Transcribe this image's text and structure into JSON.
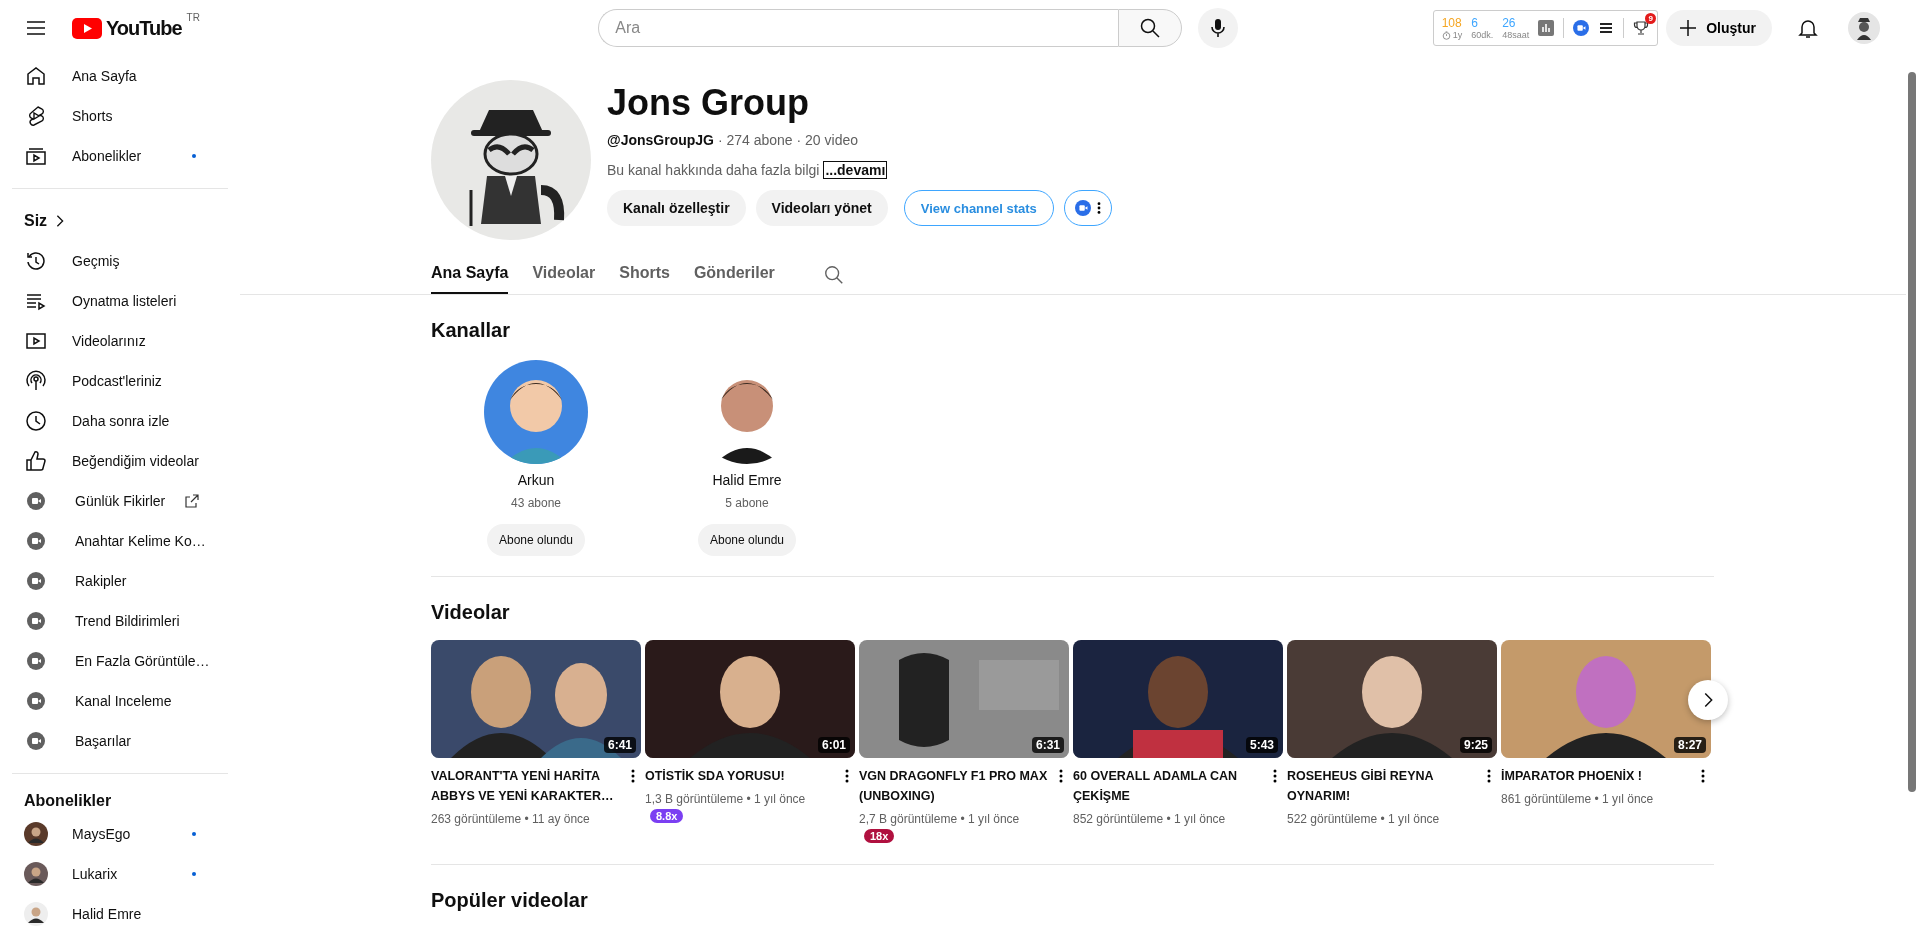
{
  "topbar": {
    "logo": "YouTube",
    "region": "TR",
    "search": {
      "placeholder": "Ara"
    },
    "extension": {
      "stats": [
        {
          "value": "108",
          "label": "1y",
          "color": "#f5a623"
        },
        {
          "value": "6",
          "label": "60dk.",
          "color": "#3ea6ff"
        },
        {
          "value": "26",
          "label": "48saat",
          "color": "#3ea6ff"
        }
      ],
      "badge": "9"
    },
    "create_button": "Oluştur"
  },
  "sidebar": {
    "main": [
      {
        "label": "Ana Sayfa",
        "new": false
      },
      {
        "label": "Shorts",
        "new": false
      },
      {
        "label": "Abonelikler",
        "new": true
      }
    ],
    "you": {
      "title": "Siz",
      "items": [
        {
          "label": "Geçmiş",
          "kind": "link",
          "external": false
        },
        {
          "label": "Oynatma listeleri",
          "kind": "link",
          "external": false
        },
        {
          "label": "Videolarınız",
          "kind": "link",
          "external": false
        },
        {
          "label": "Podcast'leriniz",
          "kind": "link",
          "external": false
        },
        {
          "label": "Daha sonra izle",
          "kind": "link",
          "external": false
        },
        {
          "label": "Beğendiğim videolar",
          "kind": "link",
          "external": false
        },
        {
          "label": "Günlük Fikirler",
          "kind": "extension",
          "external": true
        },
        {
          "label": "Anahtar Kelime Ko…",
          "kind": "extension",
          "external": false
        },
        {
          "label": "Rakipler",
          "kind": "extension",
          "external": false
        },
        {
          "label": "Trend Bildirimleri",
          "kind": "extension",
          "external": false
        },
        {
          "label": "En Fazla Görüntüle…",
          "kind": "extension",
          "external": false
        },
        {
          "label": "Kanal Inceleme",
          "kind": "extension",
          "external": false
        },
        {
          "label": "Başarılar",
          "kind": "extension",
          "external": false
        }
      ]
    },
    "subscriptions": {
      "title": "Abonelikler",
      "items": [
        {
          "label": "MaysEgo",
          "new": true
        },
        {
          "label": "Lukarix",
          "new": true
        },
        {
          "label": "Halid Emre",
          "new": false
        }
      ]
    }
  },
  "channel": {
    "name": "Jons Group",
    "handle": "@JonsGroupJG",
    "meta": "· 274 abone · 20 video",
    "description": "Bu kanal hakkında daha fazla bilgi",
    "more": "...devamı",
    "buttons": [
      {
        "label": "Kanalı özelleştir",
        "kind": "filled"
      },
      {
        "label": "Videoları yönet",
        "kind": "filled"
      },
      {
        "label": "View channel stats",
        "kind": "outline"
      }
    ],
    "tabs": [
      {
        "label": "Ana Sayfa",
        "selected": true
      },
      {
        "label": "Videolar",
        "selected": false
      },
      {
        "label": "Shorts",
        "selected": false
      },
      {
        "label": "Gönderiler",
        "selected": false
      }
    ]
  },
  "channels_section": {
    "title": "Kanallar",
    "items": [
      {
        "name": "Arkun",
        "subscribers": "43 abone",
        "button": "Abone olundu"
      },
      {
        "name": "Halid Emre",
        "subscribers": "5 abone",
        "button": "Abone olundu"
      }
    ]
  },
  "videos_section": {
    "title": "Videolar",
    "items": [
      {
        "title": "VALORANT'TA YENİ HARİTA ABBYS VE YENİ KARAKTER…",
        "duration": "6:41",
        "meta": "263 görüntüleme • 11 ay önce"
      },
      {
        "title": "OTİSTİK SDA YORUSU!",
        "duration": "6:01",
        "meta": "1,3 B görüntüleme • 1 yıl önce",
        "badge": {
          "text": "8.8x",
          "color": "#7b3ff2"
        }
      },
      {
        "title": "VGN DRAGONFLY F1 PRO MAX (UNBOXING)",
        "duration": "6:31",
        "meta": "2,7 B görüntüleme • 1 yıl önce",
        "badge": {
          "text": "18x",
          "color": "#b0103f"
        }
      },
      {
        "title": "60 OVERALL ADAMLA CAN ÇEKİŞME",
        "duration": "5:43",
        "meta": "852 görüntüleme • 1 yıl önce"
      },
      {
        "title": "ROSEHEUS GİBİ REYNA OYNARIM!",
        "duration": "9:25",
        "meta": "522 görüntüleme • 1 yıl önce"
      },
      {
        "title": "İMPARATOR PHOENİX !",
        "duration": "8:27",
        "meta": "861 görüntüleme • 1 yıl önce"
      }
    ]
  },
  "popular_section": {
    "title": "Popüler videolar"
  }
}
